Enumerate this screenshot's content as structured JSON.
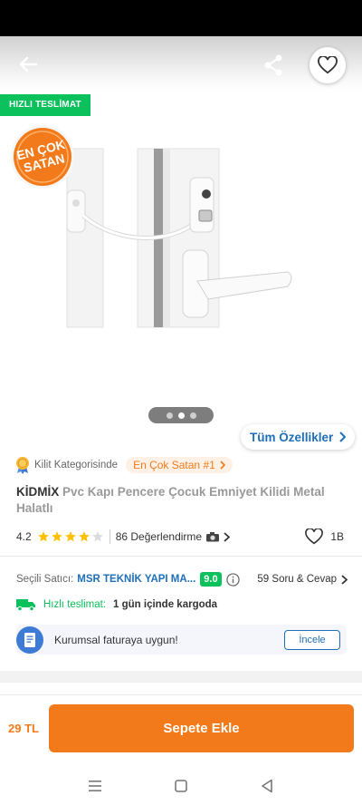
{
  "header": {
    "back_icon": "arrow-left-icon",
    "share_icon": "share-icon",
    "favorite_icon": "heart-outline-icon"
  },
  "gallery": {
    "fast_delivery_badge": "HIZLI TESLİMAT",
    "best_seller_line1": "EN ÇOK",
    "best_seller_line2": "SATAN",
    "image_count": 3,
    "active_image": 1,
    "all_features_label": "Tüm Özellikler"
  },
  "category": {
    "text": "Kilit Kategorisinde",
    "badge": "En Çok Satan #1"
  },
  "product": {
    "brand": "KİDMİX",
    "name": "Pvc Kapı Pencere Çocuk Emniyet Kilidi Metal Halatlı"
  },
  "rating": {
    "value": "4.2",
    "stars_filled": 4,
    "stars_total": 5,
    "reviews_label": "86 Değerlendirme",
    "favorites_count": "1B"
  },
  "seller": {
    "label": "Seçili Satıcı:",
    "name": "MSR TEKNİK YAPI MA...",
    "score": "9.0",
    "qa_label": "59 Soru & Cevap"
  },
  "delivery": {
    "label": "Hızlı teslimat:",
    "value": "1 gün içinde kargoda"
  },
  "corporate": {
    "text": "Kurumsal faturaya uygun!",
    "button": "İncele"
  },
  "footer": {
    "price": "29 TL",
    "add_to_cart": "Sepete Ekle"
  },
  "colors": {
    "brand_orange": "#f27a1a",
    "green": "#0bc15c",
    "link_blue": "#1f6fb8",
    "star_yellow": "#ffc000"
  }
}
